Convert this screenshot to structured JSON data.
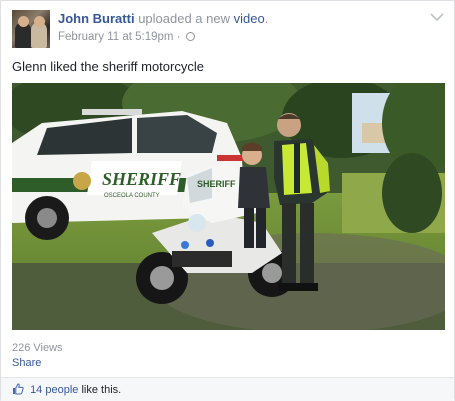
{
  "post": {
    "author": "John Buratti",
    "action": "uploaded a new",
    "object": "video",
    "period": ".",
    "timestamp": "February 11 at 5:19pm",
    "separator": "·",
    "caption": "Glenn liked the sheriff motorcycle"
  },
  "video": {
    "vehicle_text": "SHERIFF",
    "vehicle_subtext": "OSCEOLA COUNTY"
  },
  "stats": {
    "views": "226 Views",
    "share": "Share"
  },
  "likes": {
    "count": "14 people",
    "suffix": "like this."
  },
  "icons": [
    "avatar",
    "globe-icon",
    "chevron-down-icon",
    "thumbs-up-icon"
  ],
  "colors": {
    "link": "#365899",
    "meta": "#90949c",
    "text": "#1d2129"
  }
}
